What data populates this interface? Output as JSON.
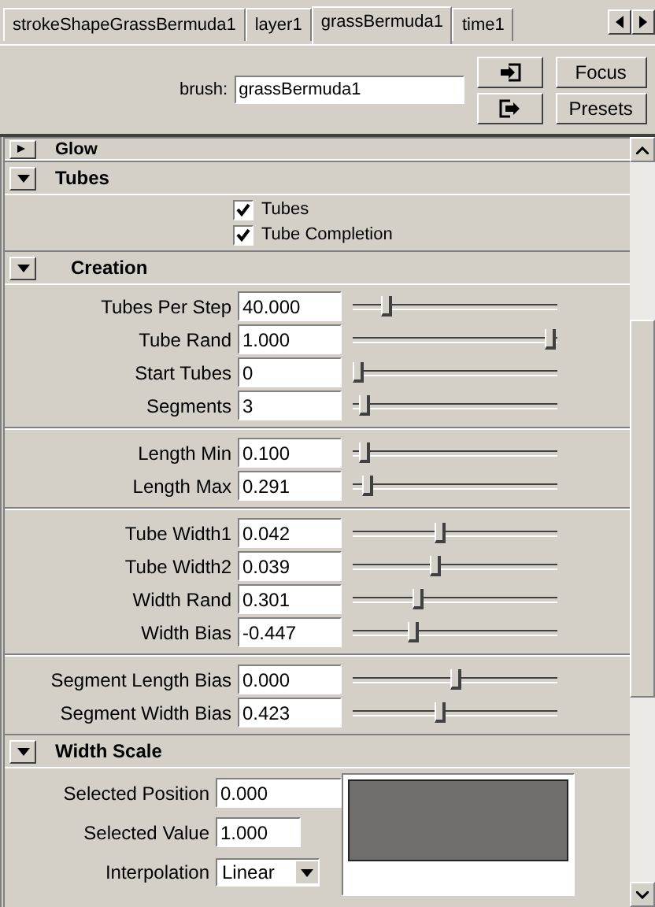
{
  "tabs": [
    {
      "label": "strokeShapeGrassBermuda1",
      "selected": false
    },
    {
      "label": "layer1",
      "selected": false
    },
    {
      "label": "grassBermuda1",
      "selected": true
    },
    {
      "label": "time1",
      "selected": false
    }
  ],
  "brush": {
    "label": "brush:",
    "value": "grassBermuda1"
  },
  "buttons": [
    {
      "label": "Focus"
    },
    {
      "label": "Presets"
    }
  ],
  "sections": [
    {
      "title": "Glow",
      "expanded": false
    },
    {
      "title": "Tubes",
      "expanded": true,
      "checkboxes": [
        {
          "label": "Tubes",
          "checked": true
        },
        {
          "label": "Tube Completion",
          "checked": true
        }
      ]
    },
    {
      "title": "Creation",
      "expanded": true,
      "groups": [
        [
          {
            "label": "Tubes Per Step",
            "value": "40.000",
            "level": 0.15
          },
          {
            "label": "Tube Rand",
            "value": "1.000",
            "level": 1
          },
          {
            "label": "Start Tubes",
            "value": "0",
            "level": 0
          },
          {
            "label": "Segments",
            "value": "3",
            "level": 0.03
          }
        ],
        [
          {
            "label": "Length Min",
            "value": "0.100",
            "level": 0.03
          },
          {
            "label": "Length Max",
            "value": "0.291",
            "level": 0.05
          }
        ],
        [
          {
            "label": "Tube Width1",
            "value": "0.042",
            "level": 0.43
          },
          {
            "label": "Tube Width2",
            "value": "0.039",
            "level": 0.4
          },
          {
            "label": "Width Rand",
            "value": "0.301",
            "level": 0.31
          },
          {
            "label": "Width Bias",
            "value": "-0.447",
            "level": 0.29
          }
        ],
        [
          {
            "label": "Segment Length Bias",
            "value": "0.000",
            "level": 0.51
          },
          {
            "label": "Segment Width Bias",
            "value": "0.423",
            "level": 0.43
          }
        ]
      ]
    },
    {
      "title": "Width Scale",
      "expanded": true,
      "fields": [
        {
          "label": "Selected Position",
          "value": "0.000"
        },
        {
          "label": "Selected Value",
          "value": "1.000"
        }
      ],
      "interpolation": {
        "label": "Interpolation",
        "value": "Linear"
      }
    }
  ]
}
